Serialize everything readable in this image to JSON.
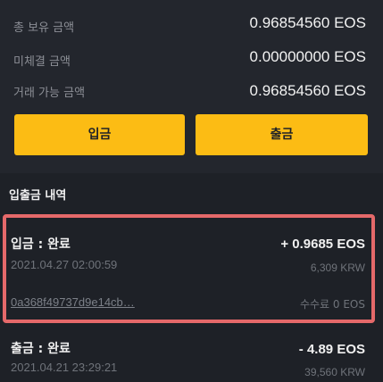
{
  "balances": [
    {
      "label": "총 보유 금액",
      "value": "0.96854560 EOS"
    },
    {
      "label": "미체결 금액",
      "value": "0.00000000 EOS"
    },
    {
      "label": "거래 가능 금액",
      "value": "0.96854560 EOS"
    }
  ],
  "buttons": {
    "deposit": "입금",
    "withdraw": "출금"
  },
  "history": {
    "title": "입출금 내역",
    "items": [
      {
        "status": "입금 : 완료",
        "datetime": "2021.04.27 02:00:59",
        "amount": "+ 0.9685 EOS",
        "krw": "6,309 KRW",
        "txid": "0a368f49737d9e14cb…",
        "fee": "수수료 0 EOS"
      },
      {
        "status": "출금 : 완료",
        "datetime": "2021.04.21 23:29:21",
        "amount": "- 4.89 EOS",
        "krw": "39,560 KRW"
      }
    ]
  },
  "colors": {
    "accent": "#fcbc14",
    "highlight": "#e5696a",
    "background": "#1e2127",
    "panel": "#23262d"
  }
}
